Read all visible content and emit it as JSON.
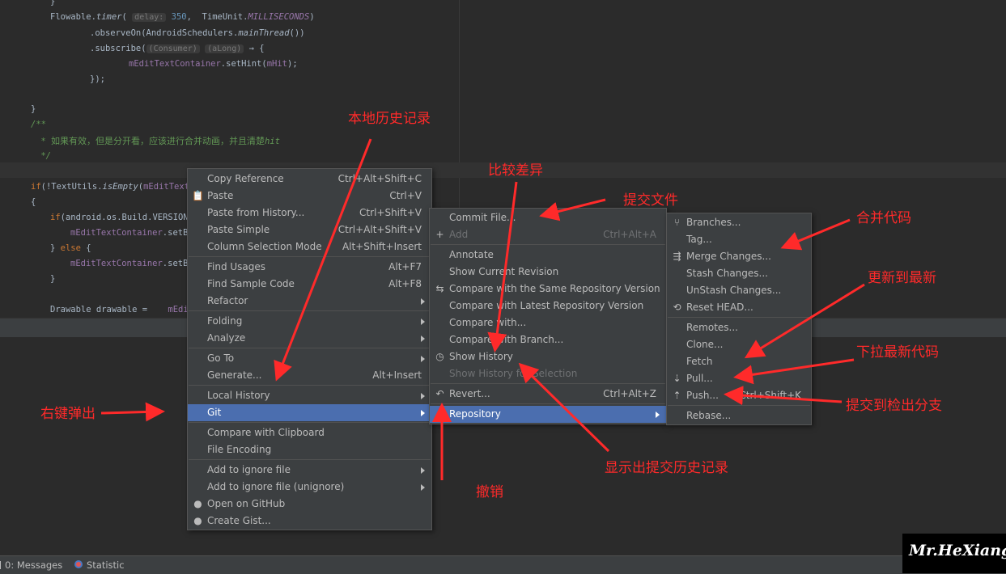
{
  "editor": {
    "lines": [
      {
        "id": "l1",
        "segs": [
          {
            "t": "}",
            "c": ""
          }
        ]
      },
      {
        "id": "l2",
        "segs": [
          {
            "t": "Flowable.",
            "c": ""
          },
          {
            "t": "timer",
            "c": "it"
          },
          {
            "t": "( ",
            "c": ""
          },
          {
            "t": "delay:",
            "c": "hint"
          },
          {
            "t": " ",
            "c": ""
          },
          {
            "t": "350",
            "c": "num"
          },
          {
            "t": ",  TimeUnit.",
            "c": ""
          },
          {
            "t": "MILLISECONDS",
            "c": "fld it"
          },
          {
            "t": ")",
            "c": ""
          }
        ]
      },
      {
        "id": "l3",
        "segs": [
          {
            "t": ".observeOn(AndroidSchedulers.",
            "c": ""
          },
          {
            "t": "mainThread",
            "c": "it"
          },
          {
            "t": "())",
            "c": ""
          }
        ]
      },
      {
        "id": "l4",
        "segs": [
          {
            "t": ".subscribe(",
            "c": ""
          },
          {
            "t": "(Consumer)",
            "c": "hint"
          },
          {
            "t": " ",
            "c": ""
          },
          {
            "t": "(aLong)",
            "c": "hint"
          },
          {
            "t": " → {",
            "c": ""
          }
        ]
      },
      {
        "id": "l5",
        "segs": [
          {
            "t": "mEditTextContainer",
            "c": "fld"
          },
          {
            "t": ".setHint(",
            "c": ""
          },
          {
            "t": "mHit",
            "c": "fld"
          },
          {
            "t": ");",
            "c": ""
          }
        ]
      },
      {
        "id": "l6",
        "segs": [
          {
            "t": "});",
            "c": ""
          }
        ]
      },
      {
        "id": "l7",
        "segs": [
          {
            "t": "}",
            "c": ""
          }
        ]
      },
      {
        "id": "l8",
        "segs": [
          {
            "t": "/**",
            "c": "cm"
          }
        ]
      },
      {
        "id": "l9",
        "segs": [
          {
            "t": " * ",
            "c": "cm"
          },
          {
            "t": "如果有效，但是分开看，应该进行合并动画，并且清楚",
            "c": "cmj"
          },
          {
            "t": "hit",
            "c": "cm"
          }
        ]
      },
      {
        "id": "l10",
        "segs": [
          {
            "t": " */",
            "c": "cm"
          }
        ]
      },
      {
        "id": "l11",
        "segs": [
          {
            "t": "if",
            "c": "kw"
          },
          {
            "t": "(!TextUtils.",
            "c": ""
          },
          {
            "t": "isEmpty",
            "c": "it"
          },
          {
            "t": "(",
            "c": ""
          },
          {
            "t": "mEditText.",
            "c": "fld"
          }
        ]
      },
      {
        "id": "l12",
        "segs": [
          {
            "t": "{",
            "c": ""
          }
        ]
      },
      {
        "id": "l13",
        "segs": [
          {
            "t": "if",
            "c": "kw"
          },
          {
            "t": "(android.os.Build.VERSION.",
            "c": ""
          }
        ]
      },
      {
        "id": "l14",
        "segs": [
          {
            "t": "mEditTextContainer",
            "c": "fld"
          },
          {
            "t": ".setBa",
            "c": ""
          }
        ]
      },
      {
        "id": "l15",
        "segs": [
          {
            "t": "} ",
            "c": ""
          },
          {
            "t": "else",
            "c": "kw"
          },
          {
            "t": " {",
            "c": ""
          }
        ]
      },
      {
        "id": "l16",
        "segs": [
          {
            "t": "mEditTextContainer",
            "c": "fld"
          },
          {
            "t": ".setBa",
            "c": ""
          }
        ]
      },
      {
        "id": "l17",
        "segs": [
          {
            "t": "}",
            "c": ""
          }
        ]
      },
      {
        "id": "l18",
        "segs": [
          {
            "t": "Drawable drawable =    ",
            "c": ""
          },
          {
            "t": "mEdit",
            "c": "fld"
          }
        ]
      }
    ]
  },
  "context_menu": {
    "items": [
      {
        "label": "Copy Reference",
        "shortcut": "Ctrl+Alt+Shift+C"
      },
      {
        "label": "Paste",
        "shortcut": "Ctrl+V",
        "icon": "clipboard-icon"
      },
      {
        "label": "Paste from History...",
        "shortcut": "Ctrl+Shift+V"
      },
      {
        "label": "Paste Simple",
        "shortcut": "Ctrl+Alt+Shift+V"
      },
      {
        "label": "Column Selection Mode",
        "shortcut": "Alt+Shift+Insert"
      },
      {
        "label": "Find Usages",
        "shortcut": "Alt+F7"
      },
      {
        "label": "Find Sample Code",
        "shortcut": "Alt+F8"
      },
      {
        "label": "Refactor",
        "submenu": true
      },
      {
        "label": "Folding",
        "submenu": true
      },
      {
        "label": "Analyze",
        "submenu": true
      },
      {
        "label": "Go To",
        "submenu": true
      },
      {
        "label": "Generate...",
        "shortcut": "Alt+Insert"
      },
      {
        "label": "Local History",
        "submenu": true
      },
      {
        "label": "Git",
        "submenu": true,
        "active": true
      },
      {
        "label": "Compare with Clipboard"
      },
      {
        "label": "File Encoding"
      },
      {
        "label": "Add to ignore file",
        "submenu": true
      },
      {
        "label": "Add to ignore file (unignore)",
        "submenu": true
      },
      {
        "label": "Open on GitHub",
        "icon": "github-icon"
      },
      {
        "label": "Create Gist...",
        "icon": "github-icon"
      }
    ]
  },
  "git_menu": {
    "items": [
      {
        "label": "Commit File..."
      },
      {
        "label": "Add",
        "shortcut": "Ctrl+Alt+A",
        "disabled": true,
        "icon": "plus-icon"
      },
      {
        "label": "Annotate"
      },
      {
        "label": "Show Current Revision"
      },
      {
        "label": "Compare with the Same Repository Version",
        "icon": "compare-icon"
      },
      {
        "label": "Compare with Latest Repository Version"
      },
      {
        "label": "Compare with..."
      },
      {
        "label": "Compare with Branch..."
      },
      {
        "label": "Show History",
        "icon": "history-icon"
      },
      {
        "label": "Show History for Selection",
        "disabled": true
      },
      {
        "label": "Revert...",
        "shortcut": "Ctrl+Alt+Z",
        "icon": "revert-icon"
      },
      {
        "label": "Repository",
        "submenu": true,
        "active": true
      }
    ]
  },
  "repo_menu": {
    "items": [
      {
        "label": "Branches...",
        "icon": "branch-icon"
      },
      {
        "label": "Tag..."
      },
      {
        "label": "Merge Changes...",
        "icon": "merge-icon"
      },
      {
        "label": "Stash Changes..."
      },
      {
        "label": "UnStash Changes..."
      },
      {
        "label": "Reset HEAD...",
        "icon": "reset-icon"
      },
      {
        "label": "Remotes..."
      },
      {
        "label": "Clone..."
      },
      {
        "label": "Fetch"
      },
      {
        "label": "Pull...",
        "icon": "vcs-pull-icon"
      },
      {
        "label": "Push...",
        "shortcut": "Ctrl+Shift+K",
        "icon": "vcs-push-icon"
      },
      {
        "label": "Rebase..."
      }
    ]
  },
  "annotations": {
    "local_history": "本地历史记录",
    "compare_diff": "比较差异",
    "commit_file": "提交文件",
    "merge_code": "合并代码",
    "update_latest": "更新到最新",
    "pull_latest": "下拉最新代码",
    "push_branch": "提交到检出分支",
    "right_click": "右键弹出",
    "show_history": "显示出提交历史记录",
    "revert": "撤销"
  },
  "statusbar": {
    "messages": "0: Messages",
    "statistic": "Statistic"
  },
  "watermark": "Mr.HeXiang",
  "colors": {
    "menu_bg": "#3c3f41",
    "menu_active": "#4b6eaf",
    "editor_bg": "#2b2b2b",
    "annotation_red": "#ff2a2a"
  }
}
